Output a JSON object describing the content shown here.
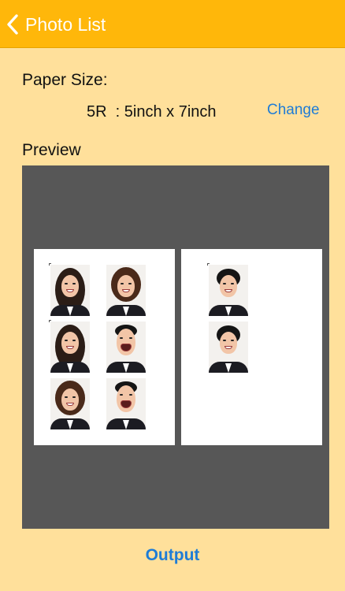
{
  "nav": {
    "title": "Photo List"
  },
  "paper": {
    "label": "Paper Size:",
    "value": "5R  : 5inch x 7inch",
    "change": "Change"
  },
  "preview": {
    "label": "Preview"
  },
  "output": {
    "label": "Output"
  },
  "colors": {
    "navbar": "#FFB70A",
    "background": "#FFE09B",
    "link": "#1E7CD6",
    "preview_bg": "#575757"
  },
  "icons": [
    "chevron-left-icon"
  ]
}
